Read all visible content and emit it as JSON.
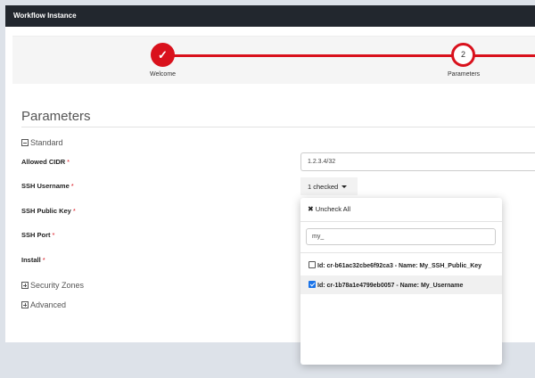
{
  "window": {
    "title": "Workflow Instance"
  },
  "wizard": {
    "steps": [
      {
        "label": "Welcome",
        "status": "done"
      },
      {
        "label": "Parameters",
        "number": "2",
        "status": "current"
      }
    ]
  },
  "page": {
    "title": "Parameters"
  },
  "sections": {
    "standard": "Standard",
    "security_zones": "Security Zones",
    "advanced": "Advanced"
  },
  "fields": {
    "allowed_cidr": {
      "label": "Allowed CIDR",
      "value": "1.2.3.4/32"
    },
    "ssh_username": {
      "label": "SSH Username",
      "selected_text": "1 checked"
    },
    "ssh_public_key": {
      "label": "SSH Public Key"
    },
    "ssh_port": {
      "label": "SSH Port"
    },
    "install": {
      "label": "Install"
    }
  },
  "required_marker": "*",
  "menu": {
    "uncheck_all": "Uncheck All",
    "filter_value": "my_",
    "options": [
      {
        "label": "Id: cr-b61ac32cbe6f92ca3 - Name: My_SSH_Public_Key",
        "checked": false
      },
      {
        "label": "Id: cr-1b78a1e4799eb0057 - Name: My_Username",
        "checked": true
      }
    ]
  },
  "colors": {
    "accent": "#d9111c",
    "titlebar": "#22272e",
    "checkbox": "#1a73e8"
  }
}
